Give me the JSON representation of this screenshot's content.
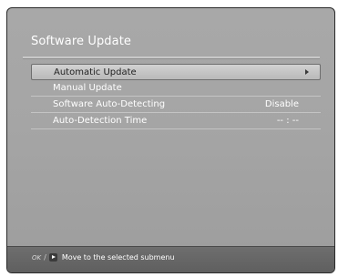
{
  "screen": {
    "title": "Software Update"
  },
  "menu": {
    "items": [
      {
        "label": "Automatic Update",
        "value": "",
        "selected": true,
        "icon": "right-arrow-icon"
      },
      {
        "label": "Manual Update",
        "value": ""
      },
      {
        "label": "Software Auto-Detecting",
        "value": "Disable"
      },
      {
        "label": "Auto-Detection Time",
        "value": "-- : --"
      }
    ]
  },
  "help_bar": {
    "ok_key": "OK",
    "separator": "/",
    "hint_text": "Move to the selected submenu"
  },
  "colors": {
    "panel_bg": "#a5a5a5",
    "help_bar_bg": "#666666",
    "text": "#ffffff",
    "highlight": "#c8c8c8"
  }
}
